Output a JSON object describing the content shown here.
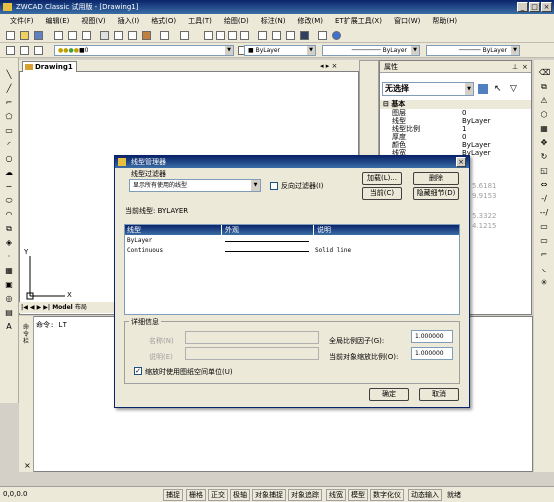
{
  "app": {
    "title": "ZWCAD Classic 试用版 - [Drawing1]"
  },
  "menu": [
    "文件(F)",
    "编辑(E)",
    "视图(V)",
    "插入(I)",
    "格式(O)",
    "工具(T)",
    "绘图(D)",
    "标注(N)",
    "修改(M)",
    "ET扩展工具(X)",
    "窗口(W)",
    "帮助(H)"
  ],
  "toolbar2": {
    "layer_value": "0",
    "color_value": "ByLayer",
    "linetype_value": "ByLayer",
    "lineweight_value": "ByLayer"
  },
  "drawing": {
    "tab_label": "Drawing1",
    "y_axis": "Y",
    "x_axis": "X",
    "model_tab": "Model",
    "layout_tab": "布局"
  },
  "properties": {
    "title": "属性",
    "selection": "无选择",
    "group": "基本",
    "rows": [
      {
        "name": "图层",
        "value": "0"
      },
      {
        "name": "线型",
        "value": "ByLayer"
      },
      {
        "name": "线型比例",
        "value": "1"
      },
      {
        "name": "厚度",
        "value": "0"
      },
      {
        "name": "颜色",
        "value": "ByLayer"
      },
      {
        "name": "线宽",
        "value": "ByLayer"
      }
    ],
    "partial_values": [
      "5.6181",
      "9.9153",
      "5.3322",
      "4.1215"
    ]
  },
  "command": {
    "side_label": "命令栏",
    "line": "命令: LT"
  },
  "status": {
    "coords": "0,0,0.0",
    "buttons": [
      "捕捉",
      "栅格",
      "正交",
      "极轴",
      "对象捕捉",
      "对象追踪",
      "线宽",
      "模型",
      "数字化仪",
      "动态输入",
      "就绪"
    ]
  },
  "dialog": {
    "title": "线型管理器",
    "filter_label": "线型过滤器",
    "filter_value": "显示所有使用的线型",
    "invert_label": "反向过滤器(I)",
    "load_button": "加载(L)...",
    "delete_button": "删除",
    "current_button": "当前(C)",
    "hide_details_button": "隐藏细节(D)",
    "current_linetype": "当前线型: BYLAYER",
    "columns": [
      "线型",
      "外观",
      "说明"
    ],
    "rows": [
      {
        "name": "ByLayer",
        "desc": ""
      },
      {
        "name": "Continuous",
        "desc": "Solid line"
      }
    ],
    "details_label": "详细信息",
    "name_label": "名称(N)",
    "desc_label": "说明(E)",
    "global_scale_label": "全局比例因子(G):",
    "global_scale_value": "1.000000",
    "current_scale_label": "当前对象缩放比例(O):",
    "current_scale_value": "1.000000",
    "paper_space_label": "缩放时使用图纸空间单位(U)",
    "ok_button": "确定",
    "cancel_button": "取消"
  }
}
